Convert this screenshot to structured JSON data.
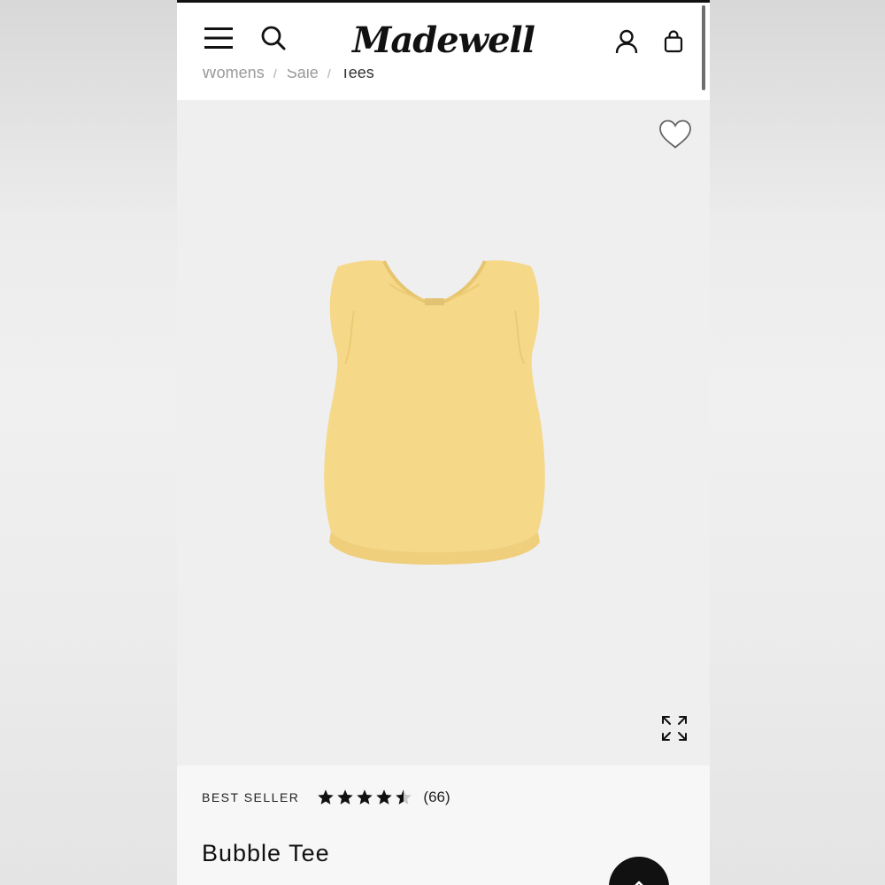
{
  "header": {
    "brand": "Madewell",
    "icons": {
      "menu": "hamburger-menu-icon",
      "search": "search-icon",
      "account": "user-icon",
      "bag": "shopping-bag-icon"
    }
  },
  "breadcrumb": {
    "items": [
      "Womens",
      "Sale",
      "Tees"
    ]
  },
  "product_image": {
    "background": "#efefef",
    "garment_color": "#f6d889",
    "icons": {
      "favorite": "heart-icon",
      "zoom": "expand-icon"
    }
  },
  "product": {
    "badge": "BEST SELLER",
    "rating": 4.5,
    "rating_max": 5,
    "review_count": "(66)",
    "title": "Bubble Tee"
  },
  "floating": {
    "back_to_top_icon": "chevron-up-icon"
  }
}
